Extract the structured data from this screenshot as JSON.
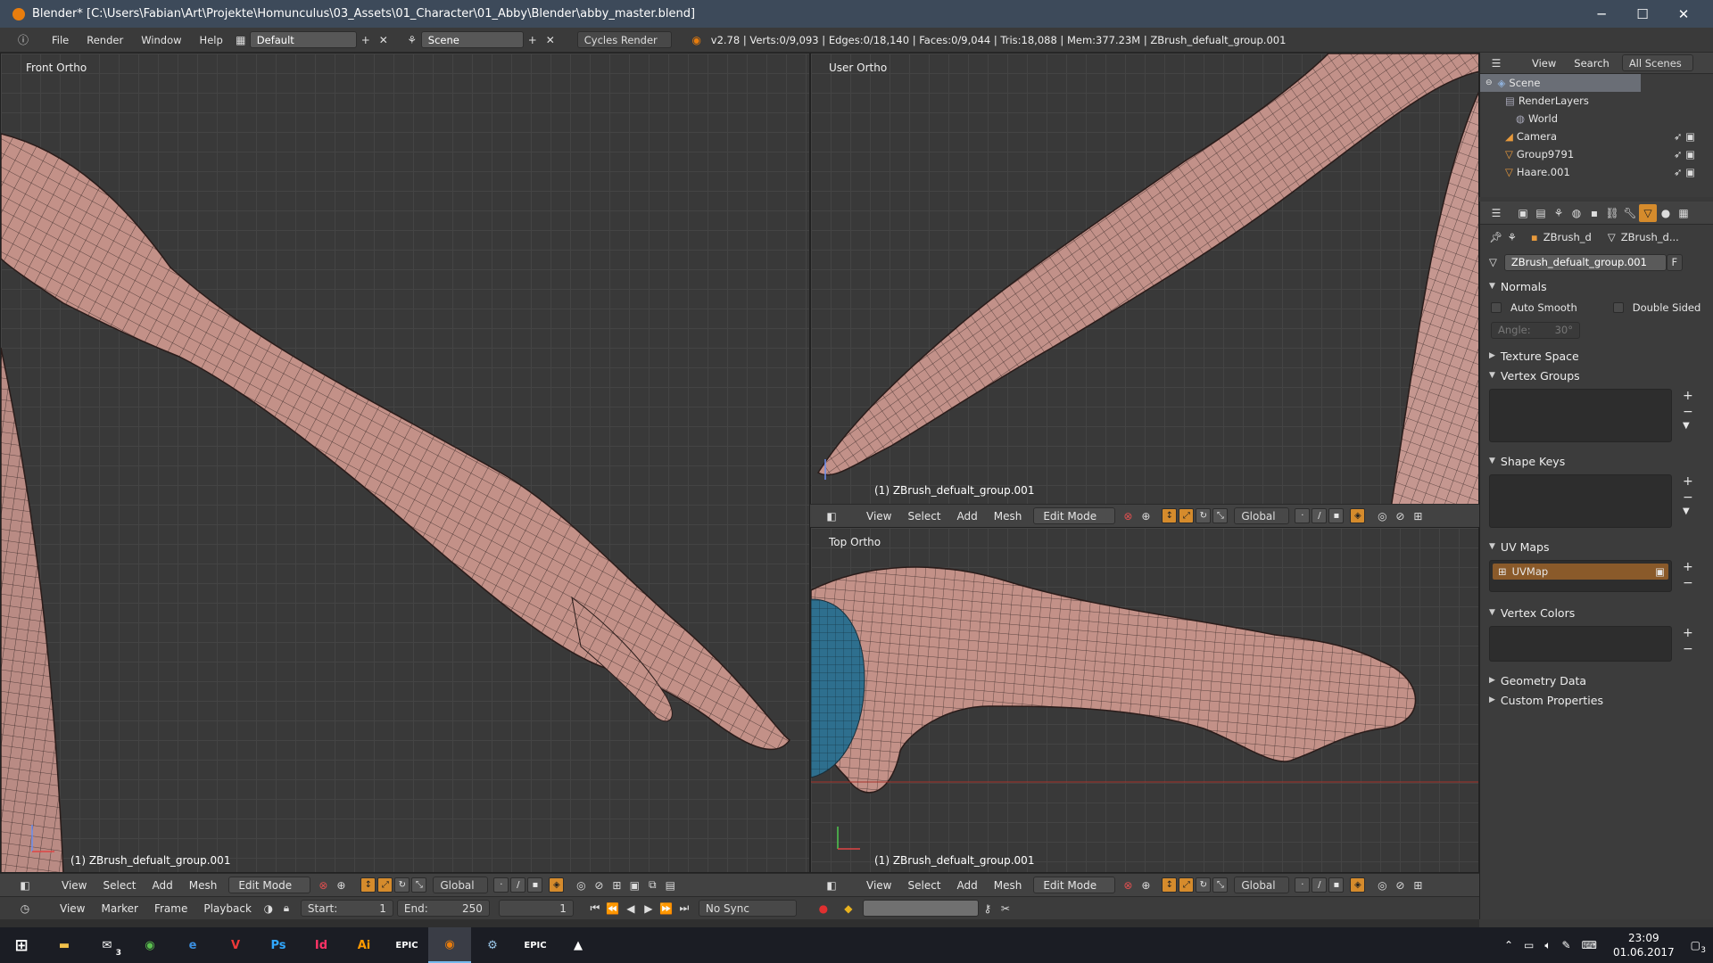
{
  "window": {
    "title": "Blender* [C:\\Users\\Fabian\\Art\\Projekte\\Homunculus\\03_Assets\\01_Character\\01_Abby\\Blender\\abby_master.blend]"
  },
  "topbar": {
    "menus": [
      "File",
      "Render",
      "Window",
      "Help"
    ],
    "layout": "Default",
    "scene": "Scene",
    "engine": "Cycles Render",
    "stats": "v2.78 | Verts:0/9,093 | Edges:0/18,140 | Faces:0/9,044 | Tris:18,088 | Mem:377.23M | ZBrush_defualt_group.001"
  },
  "viewports": {
    "front": {
      "label": "Front Ortho",
      "object": "(1) ZBrush_defualt_group.001"
    },
    "user": {
      "label": "User Ortho",
      "object": "(1) ZBrush_defualt_group.001"
    },
    "top": {
      "label": "Top Ortho",
      "object": "(1) ZBrush_defualt_group.001"
    }
  },
  "vp_header": {
    "view": "View",
    "select": "Select",
    "add": "Add",
    "mesh": "Mesh",
    "mode": "Edit Mode",
    "orientation": "Global"
  },
  "timeline": {
    "view": "View",
    "marker": "Marker",
    "frame": "Frame",
    "playback": "Playback",
    "start_label": "Start:",
    "start": "1",
    "end_label": "End:",
    "end": "250",
    "current": "1",
    "sync": "No Sync"
  },
  "outliner": {
    "tabs": [
      "View",
      "Search",
      "All Scenes"
    ],
    "items": [
      {
        "label": "Scene",
        "icon": "scene-icon"
      },
      {
        "label": "RenderLayers",
        "icon": "renderlayers-icon"
      },
      {
        "label": "World",
        "icon": "world-icon"
      },
      {
        "label": "Camera",
        "icon": "camera-icon"
      },
      {
        "label": "Group9791",
        "icon": "mesh-icon"
      },
      {
        "label": "Haare.001",
        "icon": "mesh-icon"
      }
    ]
  },
  "properties": {
    "breadcrumb_object": "ZBrush_d",
    "breadcrumb_mesh": "ZBrush_d...",
    "datablock": "ZBrush_defualt_group.001",
    "datablock_flag": "F",
    "panels": {
      "normals": "Normals",
      "auto_smooth": "Auto Smooth",
      "double_sided": "Double Sided",
      "angle_label": "Angle:",
      "angle_value": "30°",
      "texture_space": "Texture Space",
      "vertex_groups": "Vertex Groups",
      "shape_keys": "Shape Keys",
      "uv_maps": "UV Maps",
      "uv_map_item": "UVMap",
      "vertex_colors": "Vertex Colors",
      "geometry_data": "Geometry Data",
      "custom_properties": "Custom Properties"
    }
  },
  "taskbar": {
    "apps": [
      "File Explorer",
      "Mail",
      "Browser",
      "Edge",
      "Vivaldi",
      "Ps",
      "Id",
      "Ai",
      "EPIC",
      "Blender",
      "Steam",
      "EPIC",
      "Photos"
    ],
    "mail_badge": "3",
    "time": "23:09",
    "date": "01.06.2017",
    "notif_count": "3"
  },
  "colors": {
    "accent": "#d58b2c",
    "skin": "#c89a91",
    "titlebar": "#3d4a5a",
    "selection": "#4a7fb5"
  }
}
